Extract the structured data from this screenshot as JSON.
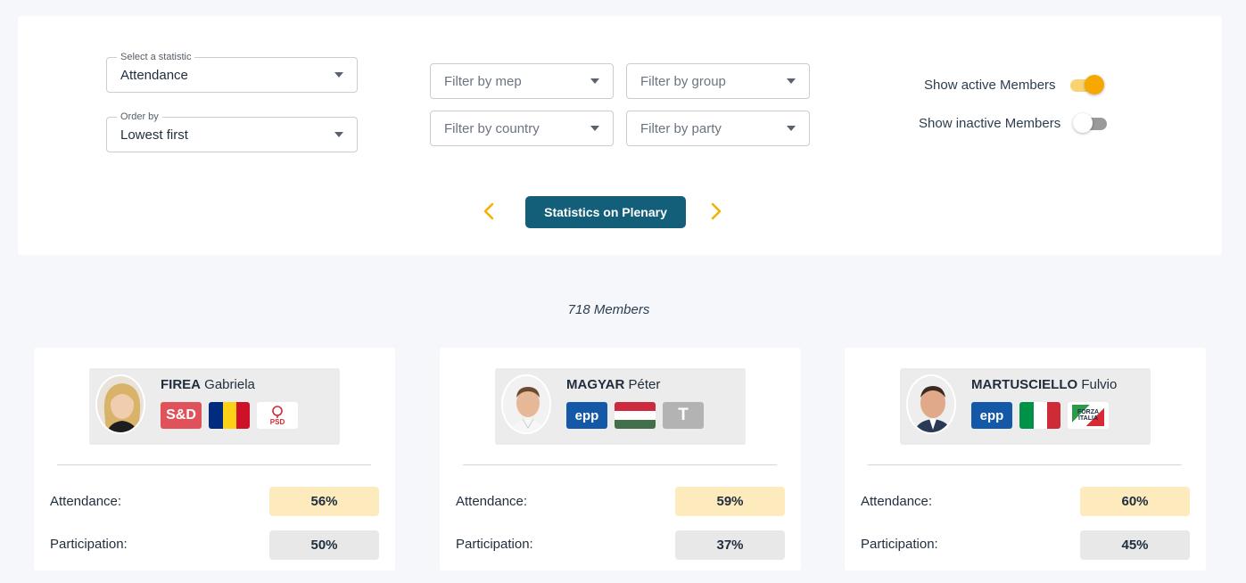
{
  "filters": {
    "statistic": {
      "legend": "Select a statistic",
      "value": "Attendance"
    },
    "order": {
      "legend": "Order by",
      "value": "Lowest first"
    },
    "mep": {
      "placeholder": "Filter by mep"
    },
    "group": {
      "placeholder": "Filter by group"
    },
    "country": {
      "placeholder": "Filter by country"
    },
    "party": {
      "placeholder": "Filter by party"
    }
  },
  "toggles": {
    "active": {
      "label": "Show active Members",
      "on": true
    },
    "inactive": {
      "label": "Show inactive Members",
      "on": false
    }
  },
  "nav": {
    "button_label": "Statistics on Plenary",
    "accent_color": "#f6b100",
    "button_color": "#135f7a"
  },
  "members_count": "718 Members",
  "cards": [
    {
      "surname": "FIREA",
      "given_name": "Gabriela",
      "group_badge": "S&D",
      "country": "Romania",
      "party_badge": "PSD",
      "attendance_label": "Attendance:",
      "attendance": "56%",
      "participation_label": "Participation:",
      "participation": "50%"
    },
    {
      "surname": "MAGYAR",
      "given_name": "Péter",
      "group_badge": "epp",
      "country": "Hungary",
      "party_badge": "T",
      "attendance_label": "Attendance:",
      "attendance": "59%",
      "participation_label": "Participation:",
      "participation": "37%"
    },
    {
      "surname": "MARTUSCIELLO",
      "given_name": "Fulvio",
      "group_badge": "epp",
      "country": "Italy",
      "party_badge": "FORZA ITALIA",
      "attendance_label": "Attendance:",
      "attendance": "60%",
      "participation_label": "Participation:",
      "participation": "45%"
    }
  ]
}
